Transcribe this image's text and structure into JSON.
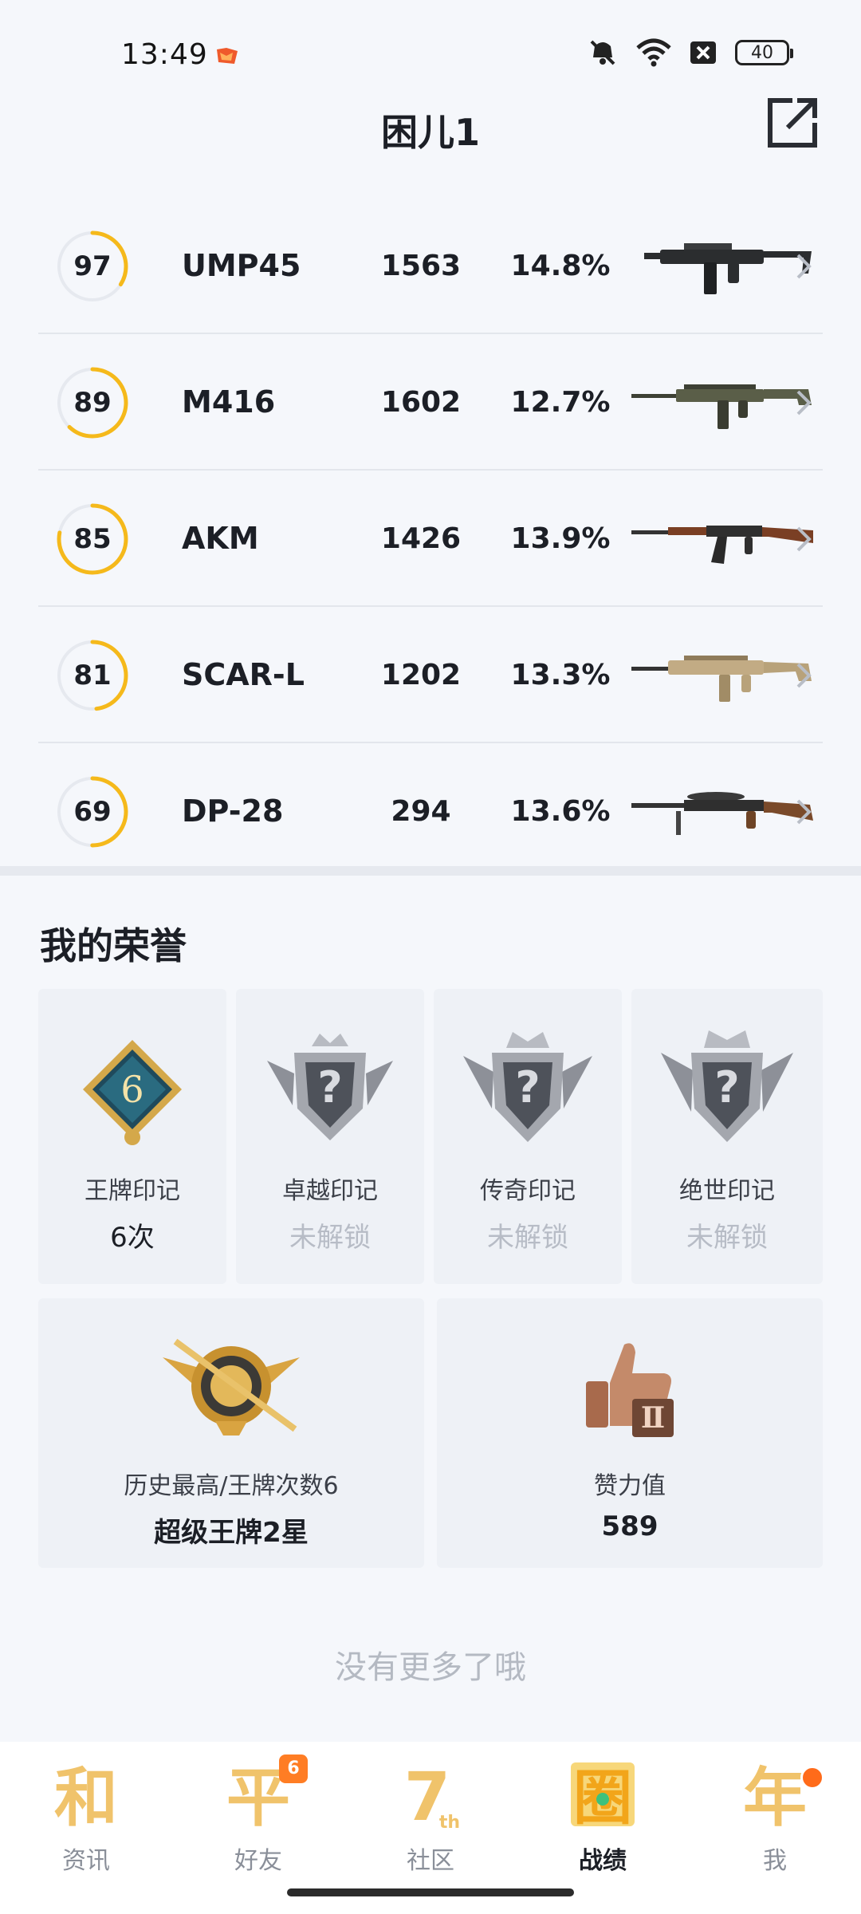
{
  "status_bar": {
    "time": "13:49",
    "battery": "40",
    "icons": [
      "app-notification-icon",
      "mute-icon",
      "wifi-icon",
      "sim-off-icon",
      "battery-icon"
    ]
  },
  "header": {
    "title": "困儿1",
    "share_icon": "share-icon"
  },
  "weapons": [
    {
      "score": "97",
      "score_fraction": 0.34,
      "name": "UMP45",
      "kills": "1563",
      "rate": "14.8%",
      "image": "ump45-smg-image"
    },
    {
      "score": "89",
      "score_fraction": 0.62,
      "name": "M416",
      "kills": "1602",
      "rate": "12.7%",
      "image": "m416-rifle-image"
    },
    {
      "score": "85",
      "score_fraction": 0.78,
      "name": "AKM",
      "kills": "1426",
      "rate": "13.9%",
      "image": "akm-rifle-image"
    },
    {
      "score": "81",
      "score_fraction": 0.48,
      "name": "SCAR-L",
      "kills": "1202",
      "rate": "13.3%",
      "image": "scar-l-rifle-image"
    },
    {
      "score": "69",
      "score_fraction": 0.5,
      "name": "DP-28",
      "kills": "294",
      "rate": "13.6%",
      "image": "dp28-lmg-image"
    }
  ],
  "honors": {
    "title": "我的荣誉",
    "marks": [
      {
        "label": "王牌印记",
        "value": "6次",
        "locked": false,
        "emblem_text": "6"
      },
      {
        "label": "卓越印记",
        "value": "未解锁",
        "locked": true,
        "emblem_text": "?"
      },
      {
        "label": "传奇印记",
        "value": "未解锁",
        "locked": true,
        "emblem_text": "?"
      },
      {
        "label": "绝世印记",
        "value": "未解锁",
        "locked": true,
        "emblem_text": "?"
      }
    ],
    "summary": [
      {
        "label": "历史最高/王牌次数6",
        "value": "超级王牌2星",
        "emblem_text": ""
      },
      {
        "label": "赞力值",
        "value": "589",
        "emblem_text": "Ⅱ"
      }
    ]
  },
  "end_text": "没有更多了哦",
  "bottom_nav": [
    {
      "glyph": "和",
      "label": "资讯",
      "active": false,
      "badge": ""
    },
    {
      "glyph": "平",
      "label": "好友",
      "active": false,
      "badge": "6"
    },
    {
      "glyph": "7",
      "glyph_sub": "th",
      "label": "社区",
      "active": false,
      "badge": ""
    },
    {
      "glyph": "圈",
      "label": "战绩",
      "active": true,
      "badge": ""
    },
    {
      "glyph": "年",
      "label": "我",
      "active": false,
      "badge": ""
    }
  ],
  "colors": {
    "ring_accent": "#f5b91b",
    "nav_gold": "#f0c36b",
    "nav_active_gold": "#f2a51a",
    "badge_orange": "#ff7d24"
  }
}
